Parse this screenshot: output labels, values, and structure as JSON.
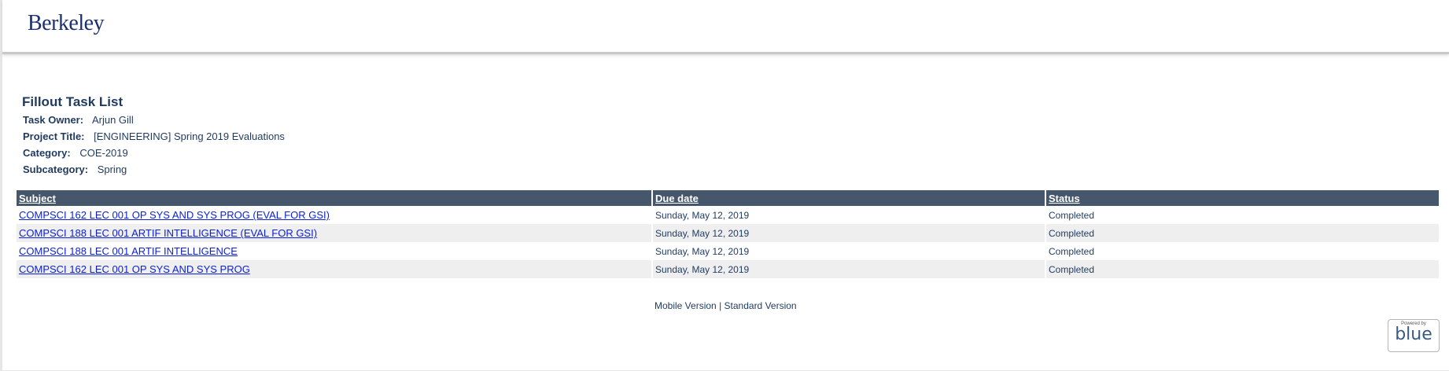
{
  "header": {
    "logo_text": "Berkeley"
  },
  "page": {
    "title": "Fillout Task List",
    "task_owner_label": "Task Owner:",
    "task_owner": "Arjun Gill",
    "project_title_label": "Project Title:",
    "project_title": "[ENGINEERING] Spring 2019 Evaluations",
    "category_label": "Category:",
    "category": "COE-2019",
    "subcategory_label": "Subcategory:",
    "subcategory": "Spring"
  },
  "table": {
    "headers": {
      "subject": "Subject",
      "due_date": "Due date",
      "status": "Status"
    },
    "rows": [
      {
        "subject": "COMPSCI 162 LEC 001 OP SYS AND SYS PROG (EVAL FOR GSI)",
        "due_date": "Sunday, May 12, 2019",
        "status": "Completed"
      },
      {
        "subject": "COMPSCI 188 LEC 001 ARTIF INTELLIGENCE (EVAL FOR GSI)",
        "due_date": "Sunday, May 12, 2019",
        "status": "Completed"
      },
      {
        "subject": "COMPSCI 188 LEC 001 ARTIF INTELLIGENCE",
        "due_date": "Sunday, May 12, 2019",
        "status": "Completed"
      },
      {
        "subject": "COMPSCI 162 LEC 001 OP SYS AND SYS PROG",
        "due_date": "Sunday, May 12, 2019",
        "status": "Completed"
      }
    ]
  },
  "footer": {
    "mobile_version": "Mobile Version",
    "separator": "|",
    "standard_version": "Standard Version",
    "powered_by": "Powered by",
    "brand": "blue"
  },
  "colors": {
    "header_row": "#46566b",
    "link": "#0b1fd8",
    "text": "#1f3a5f",
    "alt_row": "#efefef"
  }
}
